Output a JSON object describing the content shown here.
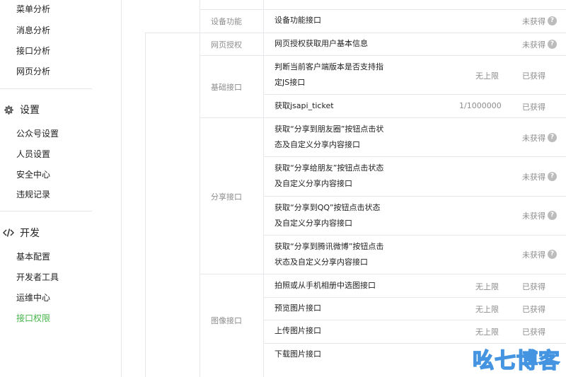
{
  "sidebar": {
    "top_items": [
      "菜单分析",
      "消息分析",
      "接口分析",
      "网页分析"
    ],
    "settings": {
      "label": "设置",
      "items": [
        "公众号设置",
        "人员设置",
        "安全中心",
        "违规记录"
      ]
    },
    "develop": {
      "label": "开发",
      "items": [
        "基本配置",
        "开发者工具",
        "运维中心",
        "接口权限"
      ],
      "active": "接口权限"
    }
  },
  "table": {
    "rows": [
      {
        "category": "设备功能",
        "api": "设备功能接口",
        "limit": "",
        "status": "未获得",
        "help": true
      },
      {
        "category": "网页授权",
        "api": "网页授权获取用户基本信息",
        "limit": "",
        "status": "未获得",
        "help": true
      },
      {
        "category": "基础接口",
        "api": "判断当前客户端版本是否支持指定JS接口",
        "limit": "无上限",
        "status": "已获得",
        "help": false
      },
      {
        "category": "",
        "api": "获取jsapi_ticket",
        "limit": "1/1000000",
        "status": "已获得",
        "help": false
      },
      {
        "category": "分享接口",
        "api": "获取“分享到朋友圈”按钮点击状态及自定义分享内容接口",
        "limit": "",
        "status": "未获得",
        "help": true
      },
      {
        "category": "",
        "api": "获取“分享给朋友”按钮点击状态及自定义分享内容接口",
        "limit": "",
        "status": "未获得",
        "help": true
      },
      {
        "category": "",
        "api": "获取“分享到QQ”按钮点击状态及自定义分享内容接口",
        "limit": "",
        "status": "未获得",
        "help": true
      },
      {
        "category": "",
        "api": "获取“分享到腾讯微博”按钮点击状态及自定义分享内容接口",
        "limit": "",
        "status": "未获得",
        "help": true
      },
      {
        "category": "图像接口",
        "api": "拍照或从手机相册中选图接口",
        "limit": "无上限",
        "status": "已获得",
        "help": false
      },
      {
        "category": "",
        "api": "预览图片接口",
        "limit": "无上限",
        "status": "已获得",
        "help": false
      },
      {
        "category": "",
        "api": "上传图片接口",
        "limit": "无上限",
        "status": "已获得",
        "help": false
      },
      {
        "category": "",
        "api": "下载图片接口",
        "limit": "",
        "status": "",
        "help": false
      }
    ],
    "api_lines": {
      "r2": [
        "判断当前客户端版本是否支持指",
        "定JS接口"
      ],
      "r4": [
        "获取“分享到朋友圈”按钮点击状",
        "态及自定义分享内容接口"
      ],
      "r5": [
        "获取“分享给朋友”按钮点击状态",
        "及自定义分享内容接口"
      ],
      "r6": [
        "获取“分享到QQ”按钮点击状态",
        "及自定义分享内容接口"
      ],
      "r7": [
        "获取“分享到腾讯微博”按钮点击",
        "状态及自定义分享内容接口"
      ]
    }
  },
  "watermark": "吆七博客",
  "colors": {
    "active": "#44b549",
    "border": "#e7e7eb",
    "muted": "#8d8d8d",
    "watermark_stroke": "#3b8fe0"
  }
}
